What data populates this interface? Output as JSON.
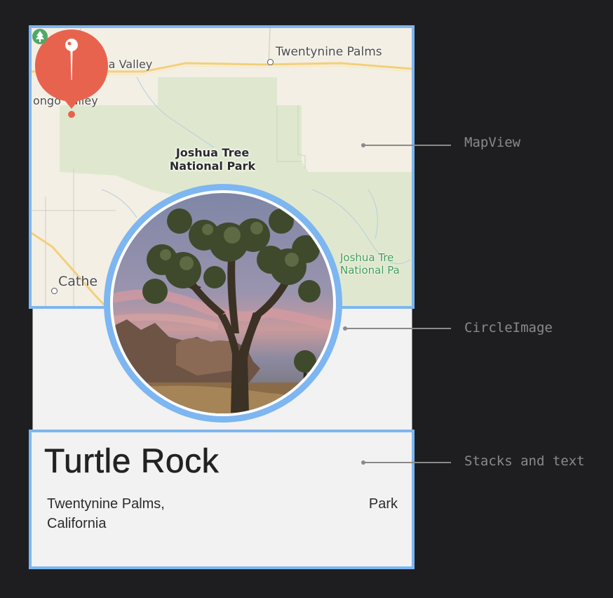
{
  "map": {
    "labels": {
      "yucca_valley": "Yucca Valley",
      "twentynine_palms": "Twentynine Palms",
      "morongo_valley": "ongo Valley",
      "cathedral": "Cathe"
    },
    "park_label_line1": "Joshua Tree",
    "park_label_line2": "National Park",
    "poi_line1": "Joshua Tre",
    "poi_line2": "National Pa",
    "pin_icon": "map-pin-icon",
    "tree_icon": "tree-icon"
  },
  "detail": {
    "title": "Turtle Rock",
    "location_line1": "Twentynine Palms,",
    "location_line2": "California",
    "category": "Park"
  },
  "annotations": {
    "mapview": "MapView",
    "circleimage": "CircleImage",
    "stacks": "Stacks and text"
  },
  "colors": {
    "background": "#1e1e20",
    "highlight_border": "#7db6f1",
    "pin": "#e8634e",
    "park_green": "#dfe8cf"
  }
}
